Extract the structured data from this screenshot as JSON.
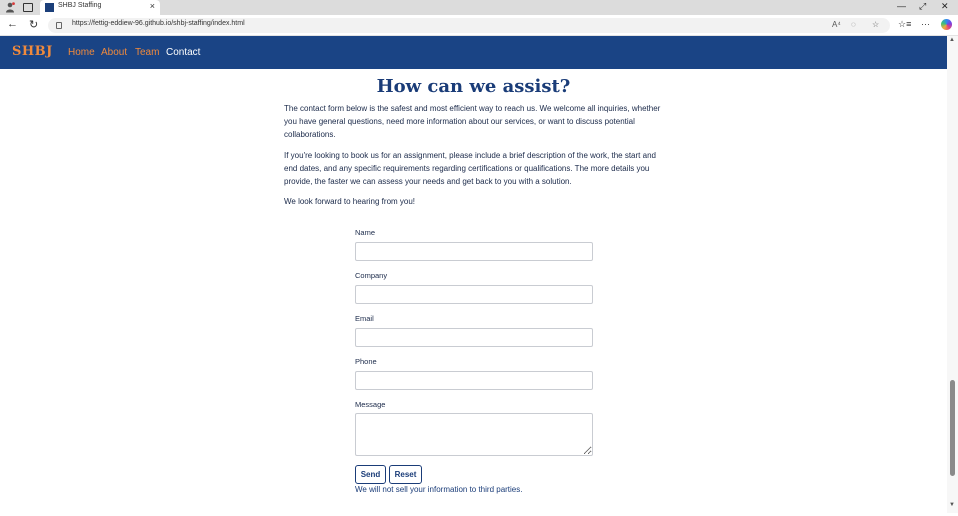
{
  "browser": {
    "tab_title": "SHBJ Staffing",
    "url": "https://fettig-eddiew-96.github.io/shbj-staffing/index.html",
    "icons": {
      "back": "←",
      "refresh": "↻",
      "close_tab": "×",
      "minimize": "—",
      "maximize": "⤢",
      "close_window": "✕",
      "read_aloud": "A⁴",
      "zoom": "◌",
      "favorite": "☆",
      "favorites": "☆≡",
      "more": "···"
    }
  },
  "site": {
    "brand": "SHBJ",
    "nav": [
      {
        "label": "Home"
      },
      {
        "label": "About"
      },
      {
        "label": "Team"
      },
      {
        "label": "Contact"
      }
    ],
    "colors": {
      "header_bg": "#1a4485",
      "accent": "#f08a3c",
      "title": "#1a3c78"
    }
  },
  "contact": {
    "title": "How can we assist?",
    "paragraphs": [
      "The contact form below is the safest and most efficient way to reach us. We welcome all inquiries, whether you have general questions, need more information about our services, or want to discuss potential collaborations.",
      "If you're looking to book us for an assignment, please include a brief description of the work, the start and end dates, and any specific requirements regarding certifications or qualifications. The more details you provide, the faster we can assess your needs and get back to you with a solution.",
      "We look forward to hearing from you!"
    ],
    "form": {
      "name_label": "Name",
      "name_value": "",
      "company_label": "Company",
      "company_value": "",
      "email_label": "Email",
      "email_value": "",
      "phone_label": "Phone",
      "phone_value": "",
      "message_label": "Message",
      "message_value": "",
      "send_label": "Send",
      "reset_label": "Reset"
    },
    "privacy_note": "We will not sell your information to third parties."
  }
}
